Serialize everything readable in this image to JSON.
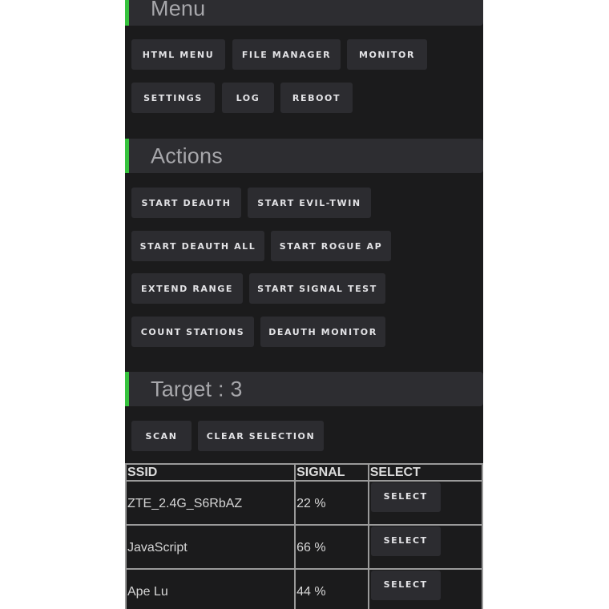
{
  "theme": {
    "accent": "#36c23d",
    "background": "#1b1b1c",
    "panel": "#2d2d31",
    "button": "#2c2c30"
  },
  "menu": {
    "title": "Menu",
    "buttons": [
      {
        "label": "HTML MENU"
      },
      {
        "label": "FILE MANAGER"
      },
      {
        "label": "MONITOR"
      },
      {
        "label": "SETTINGS"
      },
      {
        "label": "LOG"
      },
      {
        "label": "REBOOT"
      }
    ]
  },
  "actions": {
    "title": "Actions",
    "buttons": [
      {
        "label": "START DEAUTH"
      },
      {
        "label": "START EVIL-TWIN"
      },
      {
        "label": "START DEAUTH ALL"
      },
      {
        "label": "START ROGUE AP"
      },
      {
        "label": "EXTEND RANGE"
      },
      {
        "label": "START SIGNAL TEST"
      },
      {
        "label": "COUNT STATIONS"
      },
      {
        "label": "DEAUTH MONITOR"
      }
    ]
  },
  "target": {
    "title": "Target : 3",
    "buttons": [
      {
        "label": "SCAN"
      },
      {
        "label": "CLEAR SELECTION"
      }
    ],
    "table": {
      "headers": [
        "SSID",
        "SIGNAL",
        "SELECT"
      ],
      "rows": [
        {
          "ssid": "ZTE_2.4G_S6RbAZ",
          "signal": "22 %",
          "action": "SELECT"
        },
        {
          "ssid": "JavaScript",
          "signal": "66 %",
          "action": "SELECT"
        },
        {
          "ssid": "Ape Lu",
          "signal": "44 %",
          "action": "SELECT"
        }
      ]
    }
  }
}
